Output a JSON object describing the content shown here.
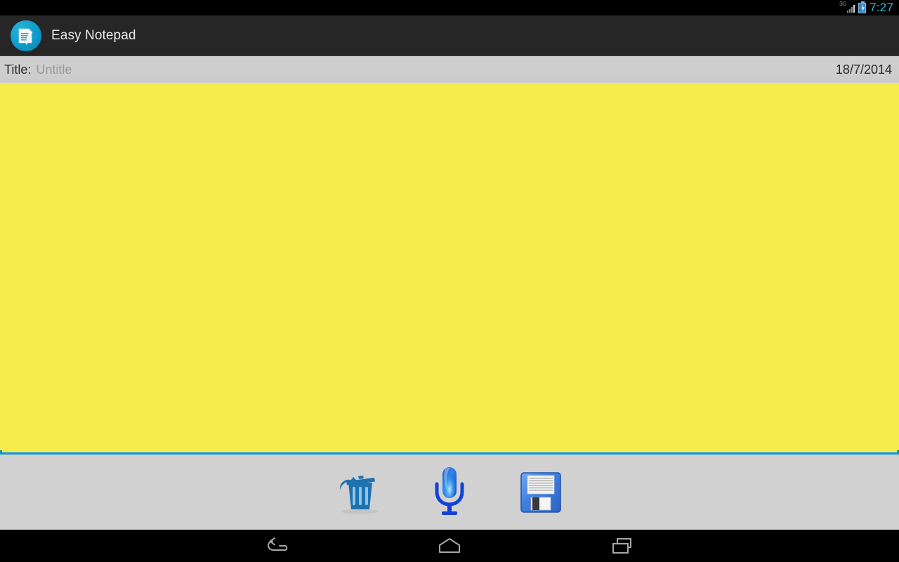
{
  "status_bar": {
    "network_type": "3G",
    "network_icon": "signal-bars-icon",
    "battery_icon": "battery-charging-icon",
    "clock": "7:27",
    "clock_color": "#34b6e4"
  },
  "action_bar": {
    "app_icon": "notepad-app-icon",
    "title": "Easy Notepad",
    "background_color": "#262626"
  },
  "title_bar": {
    "label": "Title:",
    "input_value": "",
    "input_placeholder": "Untitle",
    "date": "18/7/2014",
    "background_color": "#cccccc"
  },
  "note": {
    "text": "",
    "placeholder": "",
    "background_color": "#f5ec4b",
    "underline_color": "#0a9cc4"
  },
  "toolbar": {
    "background_color": "#d1d1d1",
    "buttons": [
      {
        "name": "delete-button",
        "icon": "trash-icon",
        "label": "Delete"
      },
      {
        "name": "voice-input-button",
        "icon": "microphone-icon",
        "label": "Voice Input"
      },
      {
        "name": "save-button",
        "icon": "floppy-disk-icon",
        "label": "Save"
      }
    ]
  },
  "nav_bar": {
    "background_color": "#000000",
    "buttons": [
      {
        "name": "nav-back-button",
        "icon": "back-arrow-icon",
        "label": "Back"
      },
      {
        "name": "nav-home-button",
        "icon": "home-icon",
        "label": "Home"
      },
      {
        "name": "nav-recents-button",
        "icon": "recents-icon",
        "label": "Recent apps"
      }
    ]
  }
}
